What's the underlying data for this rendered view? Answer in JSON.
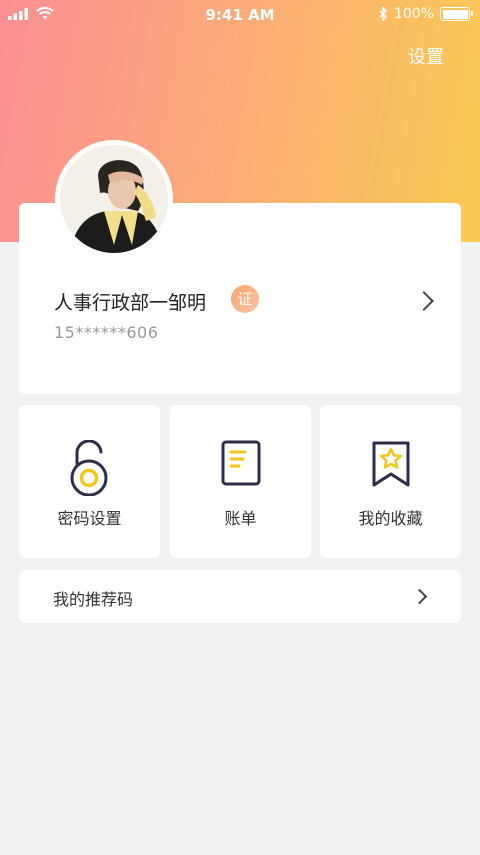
{
  "status_bar": {
    "time": "9:41 AM",
    "battery_text": "100%",
    "icons": [
      "signal-icon",
      "wifi-icon",
      "bluetooth-icon",
      "battery-icon"
    ]
  },
  "header": {
    "settings_label": "设置"
  },
  "profile": {
    "name": "人事行政部一邹明",
    "badge": "证",
    "phone": "15******606"
  },
  "tiles": [
    {
      "label": "密码设置",
      "icon": "lock-icon"
    },
    {
      "label": "账单",
      "icon": "bill-icon"
    },
    {
      "label": "我的收藏",
      "icon": "bookmark-star-icon"
    }
  ],
  "referral": {
    "label": "我的推荐码"
  },
  "colors": {
    "gradient_start": "#fb8f93",
    "gradient_end": "#f9cc52",
    "icon_dark": "#2d2d4a",
    "icon_accent": "#f5c518",
    "background": "#f2f2f2"
  }
}
